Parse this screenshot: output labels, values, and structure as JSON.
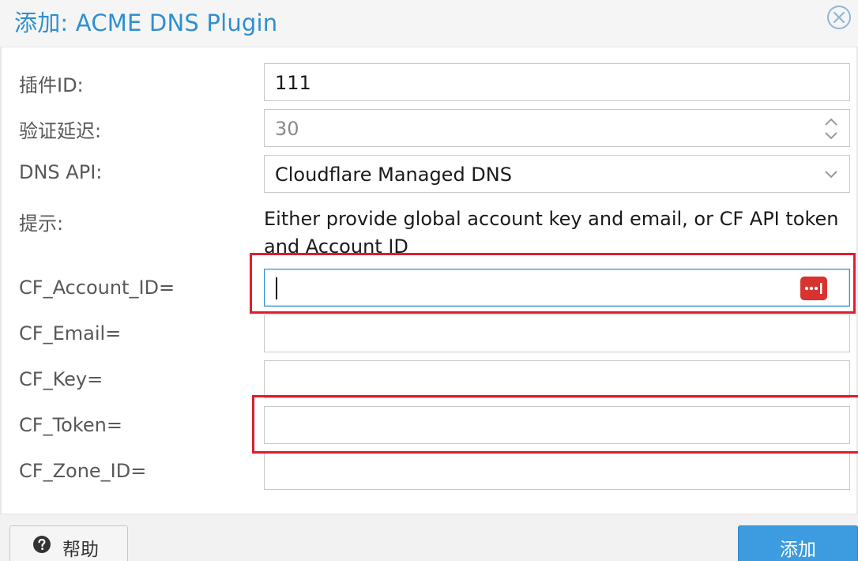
{
  "dialog": {
    "title": "添加: ACME DNS Plugin",
    "close_icon": "close-circle-icon"
  },
  "form": {
    "plugin_id": {
      "label": "插件ID:",
      "value": "111"
    },
    "validation_delay": {
      "label": "验证延迟:",
      "value": "30"
    },
    "dns_api": {
      "label": "DNS API:",
      "value": "Cloudflare Managed DNS"
    },
    "hint": {
      "label": "提示:",
      "text": "Either provide global account key and email, or CF API token and Account ID"
    },
    "cf_account_id": {
      "label": "CF_Account_ID=",
      "value": ""
    },
    "cf_email": {
      "label": "CF_Email=",
      "value": ""
    },
    "cf_key": {
      "label": "CF_Key=",
      "value": ""
    },
    "cf_token": {
      "label": "CF_Token=",
      "value": ""
    },
    "cf_zone_id": {
      "label": "CF_Zone_ID=",
      "value": ""
    }
  },
  "footer": {
    "help_label": "帮助",
    "add_label": "添加"
  },
  "colors": {
    "accent": "#2f8fd0",
    "primary_button": "#3d9be0",
    "highlight_box": "#e01c2e",
    "password_badge": "#d9332f"
  }
}
